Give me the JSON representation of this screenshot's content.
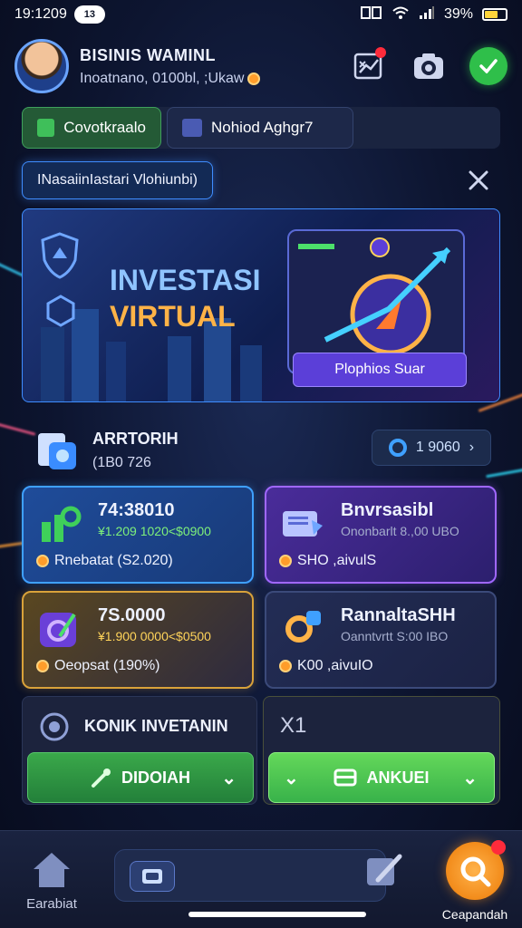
{
  "status_bar": {
    "time": "19:1209",
    "pill": "13",
    "battery": "39%"
  },
  "header": {
    "profile_name": "BISINIS WAMINL",
    "profile_sub": "Inoatnano, 0100bl, ;Ukaw"
  },
  "tabs": [
    {
      "label": "Covotkraalo"
    },
    {
      "label": "Nohiod Aghgr7"
    }
  ],
  "notice": {
    "text": "INasaiinIastari Vlohiunbi)"
  },
  "banner": {
    "title_line1": "INVESTASI",
    "title_line2": "VIRTUAL",
    "button_label": "Plophios Suar"
  },
  "portfolio": {
    "title": "ARRTORIH",
    "value": "(1B0 726",
    "button_label": "1 9060"
  },
  "cards": [
    {
      "title": "74:38010",
      "sub": "¥1.209 1020<$0900",
      "foot": "Rnebatat (S2.020)"
    },
    {
      "title": "Bnvrsasibl",
      "sub": "Ononbarlt 8.,00  UBO",
      "foot": "SHO ,aivulS"
    },
    {
      "title": "7S.0000",
      "sub": "¥1.900 0000<$0500",
      "foot": "Oeopsat (190%)"
    },
    {
      "title": "RannaltaSHH",
      "sub": "Oanntvrtt S:00  IBO",
      "foot": "K00 ,aivuIO"
    }
  ],
  "bottom": {
    "panel_title": "KONIK INVETANIN",
    "panel2_label": "X1",
    "left_button": "DIDOIAH",
    "right_button": "ANKUEI"
  },
  "navbar": {
    "home_label": "Earabiat",
    "fab_label": "Ceapandah"
  },
  "colors": {
    "accent_blue": "#3f8dff",
    "accent_green": "#3fa15c",
    "accent_purple": "#a067ff",
    "accent_gold": "#d9a23a",
    "accent_orange": "#f28b1a"
  }
}
